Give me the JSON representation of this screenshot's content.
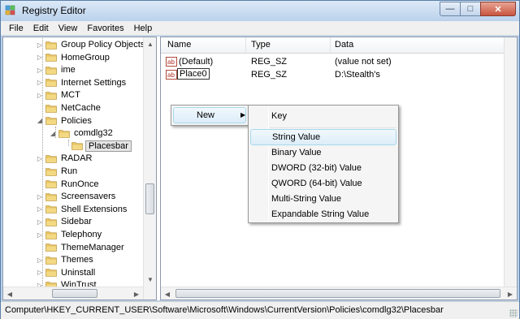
{
  "window": {
    "title": "Registry Editor",
    "buttons": {
      "minimize": "—",
      "maximize": "□",
      "close": "✕"
    }
  },
  "menu": [
    "File",
    "Edit",
    "View",
    "Favorites",
    "Help"
  ],
  "tree": {
    "items": [
      {
        "label": "Group Policy Objects",
        "arrow": "▷"
      },
      {
        "label": "HomeGroup",
        "arrow": "▷"
      },
      {
        "label": "ime",
        "arrow": "▷"
      },
      {
        "label": "Internet Settings",
        "arrow": "▷"
      },
      {
        "label": "MCT",
        "arrow": "▷"
      },
      {
        "label": "NetCache",
        "arrow": ""
      },
      {
        "label": "Policies",
        "arrow": "◢"
      },
      {
        "label": "comdlg32",
        "arrow": "◢"
      },
      {
        "label": "Placesbar",
        "arrow": ""
      },
      {
        "label": "RADAR",
        "arrow": "▷"
      },
      {
        "label": "Run",
        "arrow": ""
      },
      {
        "label": "RunOnce",
        "arrow": ""
      },
      {
        "label": "Screensavers",
        "arrow": "▷"
      },
      {
        "label": "Shell Extensions",
        "arrow": "▷"
      },
      {
        "label": "Sidebar",
        "arrow": "▷"
      },
      {
        "label": "Telephony",
        "arrow": "▷"
      },
      {
        "label": "ThemeManager",
        "arrow": ""
      },
      {
        "label": "Themes",
        "arrow": "▷"
      },
      {
        "label": "Uninstall",
        "arrow": "▷"
      },
      {
        "label": "WinTrust",
        "arrow": "▷"
      }
    ]
  },
  "list": {
    "headers": {
      "name": "Name",
      "type": "Type",
      "data": "Data"
    },
    "rows": [
      {
        "name": "(Default)",
        "type": "REG_SZ",
        "data": "(value not set)"
      },
      {
        "name": "Place0",
        "type": "REG_SZ",
        "data": "D:\\Stealth's"
      }
    ]
  },
  "context_menu": {
    "new_label": "New",
    "submenu": [
      "Key",
      "String Value",
      "Binary Value",
      "DWORD (32-bit) Value",
      "QWORD (64-bit) Value",
      "Multi-String Value",
      "Expandable String Value"
    ]
  },
  "status": "Computer\\HKEY_CURRENT_USER\\Software\\Microsoft\\Windows\\CurrentVersion\\Policies\\comdlg32\\Placesbar",
  "colors": {
    "folder": "#e8c463",
    "selection_hover": "#dcedf8",
    "title_bar": "#bcd3ec"
  }
}
